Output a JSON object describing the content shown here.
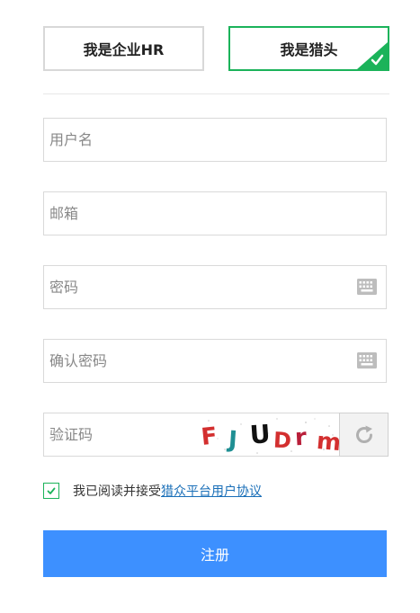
{
  "roles": {
    "hr_label": "我是企业HR",
    "hunter_label": "我是猎头",
    "selected": "hunter"
  },
  "form": {
    "username_placeholder": "用户名",
    "email_placeholder": "邮箱",
    "password_placeholder": "密码",
    "confirm_password_placeholder": "确认密码",
    "captcha_placeholder": "验证码",
    "captcha_image_text": "FJUDrm"
  },
  "agreement": {
    "checked": true,
    "prefix": "我已阅读并接受",
    "link_text": "猎众平台用户协议"
  },
  "submit_label": "注册",
  "icons": {
    "keyboard": "keyboard-icon",
    "refresh": "refresh-icon",
    "check": "check-icon"
  },
  "colors": {
    "selected_border": "#1bb35a",
    "primary_button": "#3d90ff",
    "link": "#1a6fb8"
  }
}
